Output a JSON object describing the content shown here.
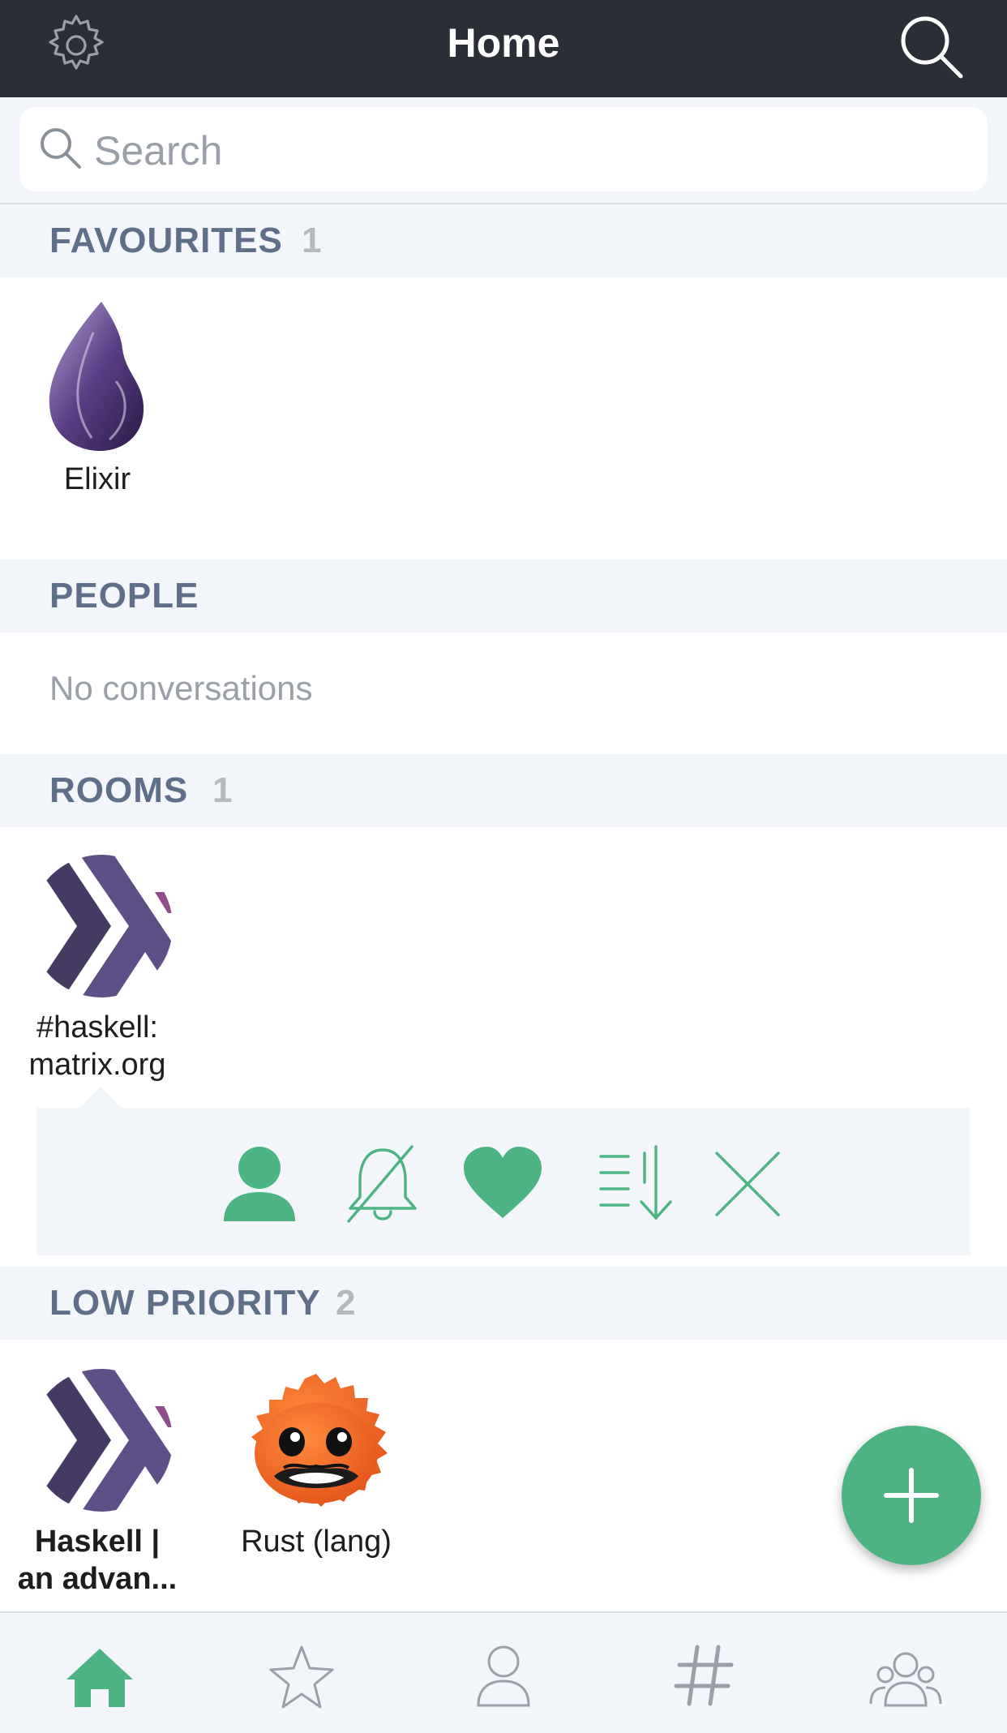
{
  "header": {
    "title": "Home"
  },
  "search": {
    "placeholder": "Search"
  },
  "favourites": {
    "label": "FAVOURITES",
    "count": "1",
    "rooms": [
      {
        "name": "Elixir"
      }
    ]
  },
  "people": {
    "label": "PEOPLE",
    "empty_text": "No conversations"
  },
  "rooms": {
    "label": "ROOMS",
    "count": "1",
    "items": [
      {
        "name_line1": "#haskell:",
        "name_line2": "matrix.org"
      }
    ]
  },
  "action_menu": {
    "icons": [
      "person-icon",
      "bell-off-icon",
      "heart-icon",
      "sort-icon",
      "close-icon"
    ]
  },
  "low_priority": {
    "label": "LOW PRIORITY",
    "count": "2",
    "items": [
      {
        "name_line1": "Haskell |",
        "name_line2": "an advan..."
      },
      {
        "name": "Rust (lang)"
      }
    ]
  },
  "bottom_tabs": [
    "home-icon",
    "star-icon",
    "person-icon",
    "hash-icon",
    "group-icon"
  ],
  "colors": {
    "accent": "#4db383",
    "topbar": "#2a2e37",
    "section_bg": "#f2f5f9",
    "section_text": "#5f6f8a"
  }
}
